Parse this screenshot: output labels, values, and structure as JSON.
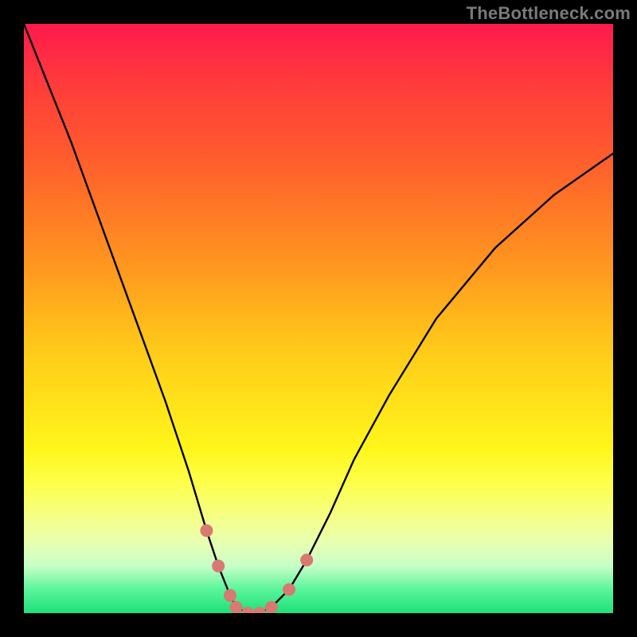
{
  "watermark": "TheBottleneck.com",
  "chart_data": {
    "type": "line",
    "title": "",
    "xlabel": "",
    "ylabel": "",
    "xlim": [
      0,
      100
    ],
    "ylim": [
      0,
      100
    ],
    "grid": false,
    "series": [
      {
        "name": "curve",
        "color": "#000000",
        "x": [
          0,
          4,
          8,
          12,
          16,
          20,
          24,
          28,
          31,
          33,
          35,
          36,
          38,
          40,
          42,
          45,
          48,
          52,
          56,
          62,
          70,
          80,
          90,
          100
        ],
        "y": [
          100,
          90,
          80,
          69,
          58,
          47,
          36,
          24,
          14,
          8,
          3,
          1,
          0,
          0,
          1,
          4,
          9,
          17,
          26,
          37,
          50,
          62,
          71,
          78
        ]
      }
    ],
    "markers": {
      "name": "highlight-dots",
      "color": "#d67a72",
      "radius_px": 8,
      "points": [
        {
          "x": 31.0,
          "y": 14.0
        },
        {
          "x": 33.0,
          "y": 8.0
        },
        {
          "x": 35.0,
          "y": 3.0
        },
        {
          "x": 36.0,
          "y": 1.0
        },
        {
          "x": 38.0,
          "y": 0.0
        },
        {
          "x": 40.0,
          "y": 0.0
        },
        {
          "x": 42.0,
          "y": 1.0
        },
        {
          "x": 45.0,
          "y": 4.0
        },
        {
          "x": 48.0,
          "y": 9.0
        }
      ]
    }
  }
}
